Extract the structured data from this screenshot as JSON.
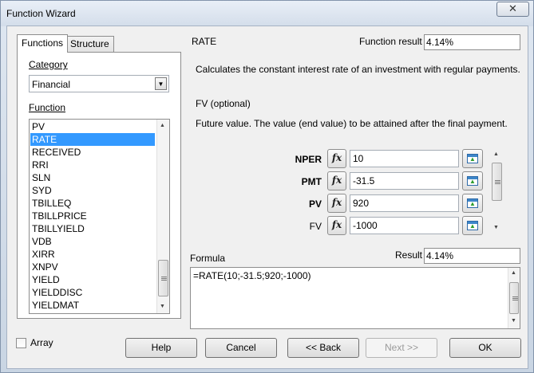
{
  "window": {
    "title": "Function Wizard",
    "close_glyph": "✕"
  },
  "tabs": [
    {
      "label": "Functions",
      "active": true
    },
    {
      "label": "Structure",
      "active": false
    }
  ],
  "category": {
    "label": "Category",
    "value": "Financial"
  },
  "function_list": {
    "label": "Function",
    "items": [
      "PV",
      "RATE",
      "RECEIVED",
      "RRI",
      "SLN",
      "SYD",
      "TBILLEQ",
      "TBILLPRICE",
      "TBILLYIELD",
      "VDB",
      "XIRR",
      "XNPV",
      "YIELD",
      "YIELDDISC",
      "YIELDMAT"
    ],
    "selected": "RATE"
  },
  "function_info": {
    "name": "RATE",
    "result_label": "Function result",
    "result_value": "4.14%",
    "description": "Calculates the constant interest rate of an investment with regular payments.",
    "param_title": "FV (optional)",
    "param_description": "Future value. The value (end value) to be attained after the final payment."
  },
  "params": [
    {
      "name": "NPER",
      "value": "10",
      "bold": true
    },
    {
      "name": "PMT",
      "value": "-31.5",
      "bold": true
    },
    {
      "name": "PV",
      "value": "920",
      "bold": true
    },
    {
      "name": "FV",
      "value": "-1000",
      "bold": false
    }
  ],
  "formula": {
    "label": "Formula",
    "result_label": "Result",
    "result_value": "4.14%",
    "text": "=RATE(10;-31.5;920;-1000)"
  },
  "array_checkbox": {
    "label": "Array",
    "checked": false
  },
  "buttons": {
    "help": "Help",
    "cancel": "Cancel",
    "back": "<< Back",
    "next": "Next >>",
    "ok": "OK"
  },
  "icons": {
    "fx": "function-wizard-icon",
    "shrink": "shrink-dialog-icon"
  }
}
